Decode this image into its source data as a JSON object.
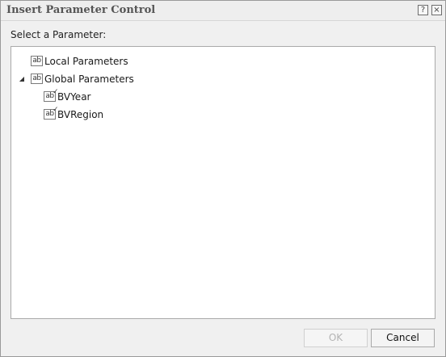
{
  "window": {
    "title": "Insert Parameter Control",
    "help_icon": "?",
    "close_icon": "×"
  },
  "prompt": "Select a Parameter:",
  "tree": {
    "local": {
      "label": "Local Parameters",
      "icon_text": "ab"
    },
    "global": {
      "label": "Global Parameters",
      "icon_text": "ab",
      "toggle": "◢",
      "expanded": true,
      "children": [
        {
          "label": "BVYear",
          "icon_text": "ab"
        },
        {
          "label": "BVRegion",
          "icon_text": "ab"
        }
      ]
    }
  },
  "buttons": {
    "ok_label": "OK",
    "ok_enabled": false,
    "cancel_label": "Cancel"
  }
}
